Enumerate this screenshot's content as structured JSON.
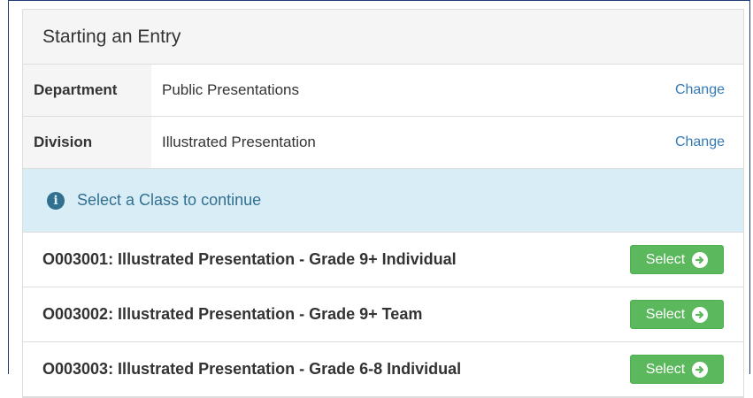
{
  "panel": {
    "heading": "Starting an Entry"
  },
  "info_rows": [
    {
      "label": "Department",
      "value": "Public Presentations",
      "link": "Change"
    },
    {
      "label": "Division",
      "value": "Illustrated Presentation",
      "link": "Change"
    }
  ],
  "alert": {
    "text": "Select a Class to continue"
  },
  "classes": [
    {
      "title": "O003001: Illustrated Presentation - Grade 9+ Individual",
      "button": "Select"
    },
    {
      "title": "O003002: Illustrated Presentation - Grade 9+ Team",
      "button": "Select"
    },
    {
      "title": "O003003: Illustrated Presentation - Grade 6-8 Individual",
      "button": "Select"
    }
  ],
  "colors": {
    "link": "#337ab7",
    "alert_bg": "#d9edf7",
    "alert_text": "#31708f",
    "button_green": "#5cb85c"
  }
}
